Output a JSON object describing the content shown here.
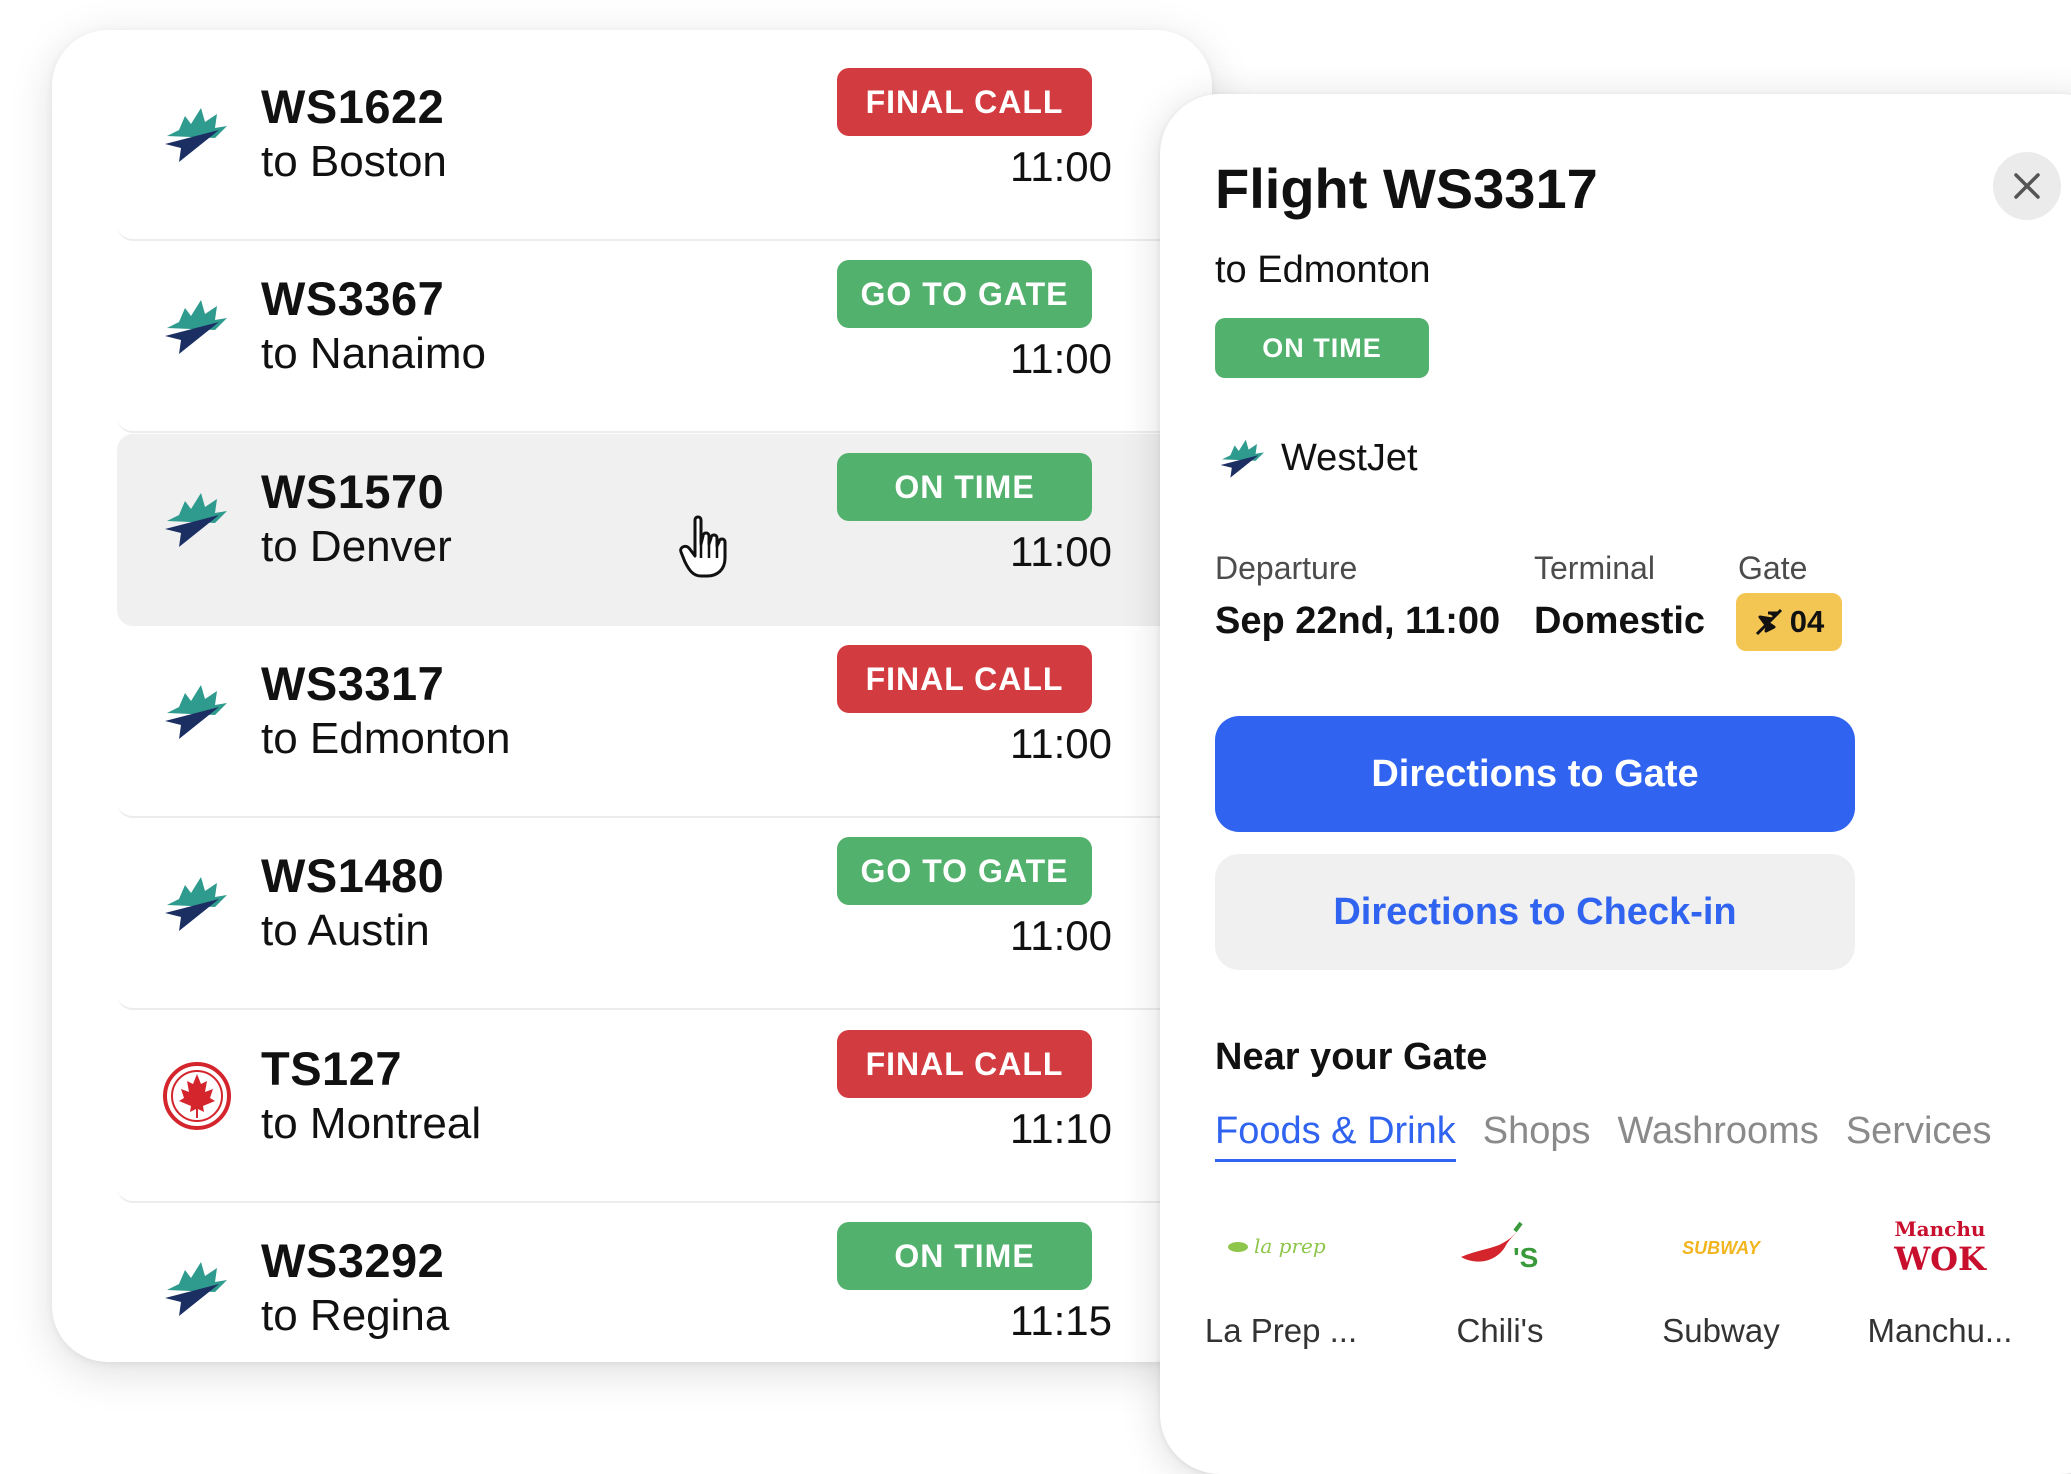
{
  "flights": [
    {
      "number": "WS1622",
      "destination": "to Boston",
      "status": "FINAL CALL",
      "status_color": "#d23b3f",
      "time": "11:00",
      "airline_icon": "westjet-logo-icon"
    },
    {
      "number": "WS3367",
      "destination": "to Nanaimo",
      "status": "GO TO GATE",
      "status_color": "#52b16c",
      "time": "11:00",
      "airline_icon": "westjet-logo-icon"
    },
    {
      "number": "WS1570",
      "destination": "to Denver",
      "status": "ON TIME",
      "status_color": "#52b16c",
      "time": "11:00",
      "airline_icon": "westjet-logo-icon"
    },
    {
      "number": "WS3317",
      "destination": "to Edmonton",
      "status": "FINAL CALL",
      "status_color": "#d23b3f",
      "time": "11:00",
      "airline_icon": "westjet-logo-icon"
    },
    {
      "number": "WS1480",
      "destination": "to Austin",
      "status": "GO TO GATE",
      "status_color": "#52b16c",
      "time": "11:00",
      "airline_icon": "westjet-logo-icon"
    },
    {
      "number": "TS127",
      "destination": "to Montreal",
      "status": "FINAL CALL",
      "status_color": "#d23b3f",
      "time": "11:10",
      "airline_icon": "maple-leaf-roundel-icon"
    },
    {
      "number": "WS3292",
      "destination": "to Regina",
      "status": "ON TIME",
      "status_color": "#52b16c",
      "time": "11:15",
      "airline_icon": "westjet-logo-icon"
    }
  ],
  "detail": {
    "title": "Flight WS3317",
    "destination": "to Edmonton",
    "status": "ON TIME",
    "airline": "WestJet",
    "departure_label": "Departure",
    "departure_value": "Sep 22nd, 11:00",
    "terminal_label": "Terminal",
    "terminal_value": "Domestic",
    "gate_label": "Gate",
    "gate_value": "04",
    "primary_button": "Directions to Gate",
    "secondary_button": "Directions to Check-in",
    "near_title": "Near your Gate",
    "tabs": [
      "Foods & Drink",
      "Shops",
      "Washrooms",
      "Services"
    ],
    "active_tab": "Foods & Drink",
    "places": [
      {
        "name": "La Prep ...",
        "logo_text": "la prep"
      },
      {
        "name": "Chili's",
        "logo_text": "'S"
      },
      {
        "name": "Subway",
        "logo_text": "SUBWAY"
      },
      {
        "name": "Manchu...",
        "logo_text_top": "Manchu",
        "logo_text_bottom": "WOK"
      }
    ]
  },
  "colors": {
    "final_call": "#d23b3f",
    "on_time": "#52b16c",
    "primary": "#2f63f0",
    "gate_badge": "#f3c553"
  }
}
